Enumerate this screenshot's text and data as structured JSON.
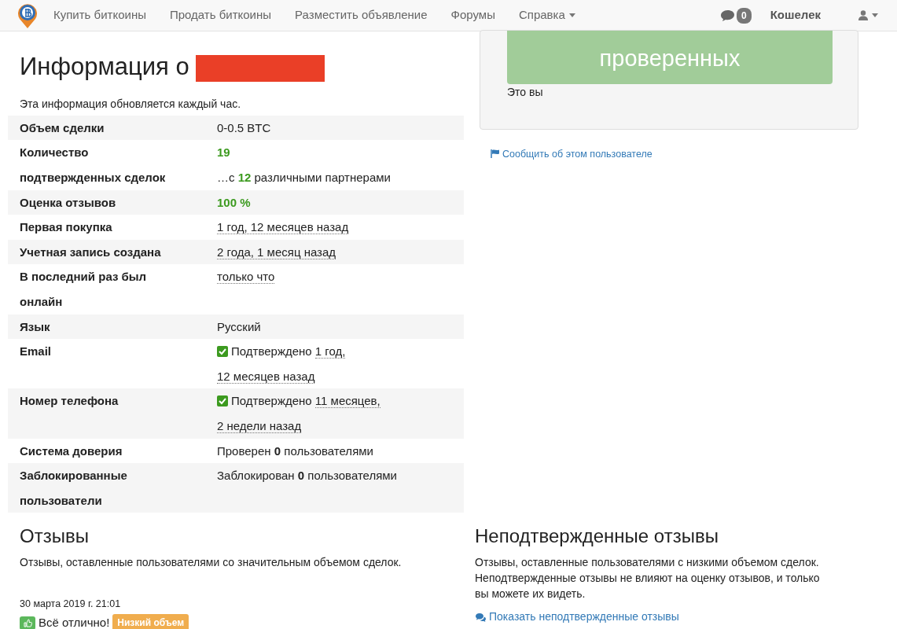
{
  "navbar": {
    "links": [
      {
        "label": "Купить биткоины"
      },
      {
        "label": "Продать биткоины"
      },
      {
        "label": "Разместить объявление"
      },
      {
        "label": "Форумы"
      },
      {
        "label": "Справка",
        "dropdown": true
      }
    ],
    "messages_count": "0",
    "wallet": "Кошелек"
  },
  "profile": {
    "title": "Информация о",
    "note": "Эта информация обновляется каждый час.",
    "rows": [
      {
        "label": "Объем сделки",
        "value": [
          {
            "kind": "text",
            "text": "0-0.5 BTC"
          }
        ]
      },
      {
        "label": "Количество подтвержденных сделок",
        "value": [
          {
            "kind": "green",
            "text": "19"
          },
          {
            "kind": "break"
          },
          {
            "kind": "text",
            "text": "…с "
          },
          {
            "kind": "green",
            "text": "12"
          },
          {
            "kind": "text",
            "text": " различными партнерами"
          }
        ]
      },
      {
        "label": "Оценка отзывов",
        "value": [
          {
            "kind": "green",
            "text": "100 %"
          }
        ]
      },
      {
        "label": "Первая покупка",
        "value": [
          {
            "kind": "time",
            "text": "1 год, 12 месяцев назад"
          }
        ]
      },
      {
        "label": "Учетная запись создана",
        "value": [
          {
            "kind": "time",
            "text": "2 года, 1 месяц назад"
          }
        ]
      },
      {
        "label": "В последний раз был онлайн",
        "value": [
          {
            "kind": "time",
            "text": "только что"
          }
        ]
      },
      {
        "label": "Язык",
        "value": [
          {
            "kind": "text",
            "text": "Русский"
          }
        ]
      },
      {
        "label": "Email",
        "value": [
          {
            "kind": "check",
            "checked": true
          },
          {
            "kind": "text",
            "text": "Подтверждено "
          },
          {
            "kind": "time",
            "text": "1 год,"
          },
          {
            "kind": "break"
          },
          {
            "kind": "time",
            "text": "12 месяцев назад"
          }
        ]
      },
      {
        "label": "Номер телефона",
        "value": [
          {
            "kind": "check",
            "checked": true
          },
          {
            "kind": "text",
            "text": "Подтверждено "
          },
          {
            "kind": "time",
            "text": "11 месяцев,"
          },
          {
            "kind": "break"
          },
          {
            "kind": "time",
            "text": "2 недели назад"
          }
        ]
      },
      {
        "label": "Система доверия",
        "value": [
          {
            "kind": "text",
            "text": "Проверен "
          },
          {
            "kind": "strong",
            "text": "0"
          },
          {
            "kind": "text",
            "text": " пользователями"
          }
        ]
      },
      {
        "label": "Заблокированные пользователи",
        "value": [
          {
            "kind": "text",
            "text": "Заблокирован "
          },
          {
            "kind": "strong",
            "text": "0"
          },
          {
            "kind": "text",
            "text": " пользователями"
          }
        ]
      }
    ]
  },
  "side_panel": {
    "button": "проверенных",
    "caption": "Это вы"
  },
  "report_link": "Сообщить об этом пользователе",
  "feedback": {
    "title": "Отзывы",
    "description": "Отзывы, оставленные пользователями со значительным объемом сделок.",
    "items": [
      {
        "date": "30 марта 2019 г. 21:01",
        "text": "Всё отлично!",
        "tag": "Низкий объем"
      }
    ]
  },
  "unconfirmed": {
    "title": "Неподтвержденные отзывы",
    "description": "Отзывы, оставленные пользователями с низкими объемом сделок. Неподтвержденные отзывы не влияют на оценку отзывов, и только вы можете их видеть.",
    "link": "Показать неподтвержденные отзывы"
  }
}
